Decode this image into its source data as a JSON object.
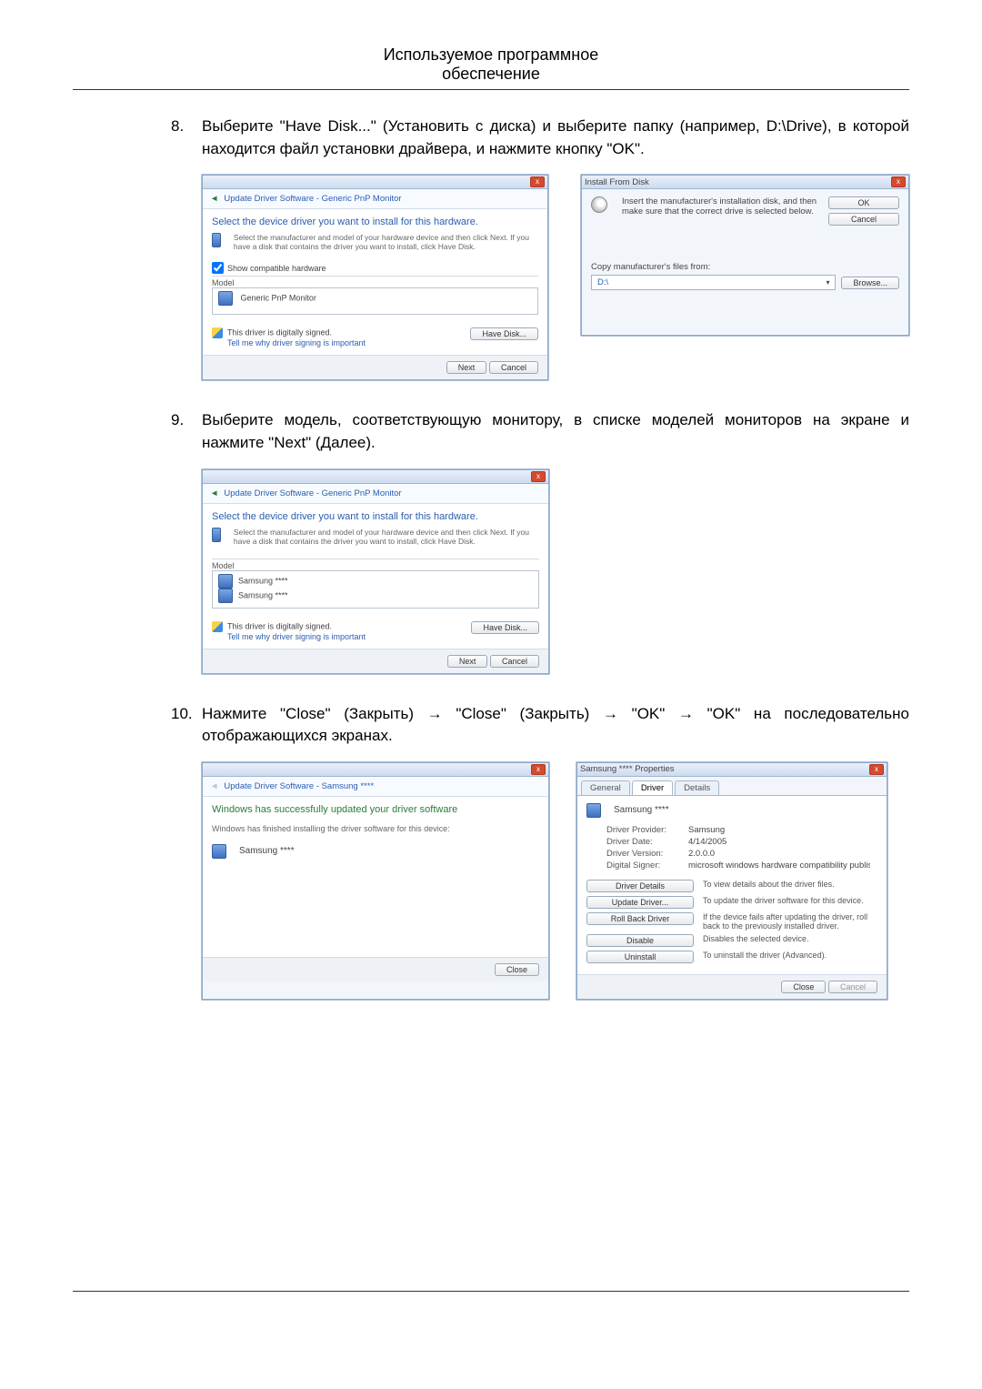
{
  "header": {
    "line1": "Используемое программное",
    "line2": "обеспечение"
  },
  "steps": {
    "s8": {
      "num": "8.",
      "text": "Выберите \"Have Disk...\" (Установить с диска) и выберите папку (например, D:\\Drive), в которой находится файл установки драйвера, и нажмите кнопку \"OK\"."
    },
    "s9": {
      "num": "9.",
      "text": "Выберите модель, соответствующую монитору, в списке моделей мониторов на экране и нажмите \"Next\" (Далее)."
    },
    "s10": {
      "num": "10.",
      "text": "Нажмите \"Close\" (Закрыть) → \"Close\" (Закрыть) → \"OK\" → \"OK\" на последовательно отображающихся экранах."
    }
  },
  "dlg_select1": {
    "title": "Update Driver Software - Generic PnP Monitor",
    "heading": "Select the device driver you want to install for this hardware.",
    "hint": "Select the manufacturer and model of your hardware device and then click Next. If you have a disk that contains the driver you want to install, click Have Disk.",
    "compat": "Show compatible hardware",
    "model_label": "Model",
    "model_item": "Generic PnP Monitor",
    "signed": "This driver is digitally signed.",
    "tell": "Tell me why driver signing is important",
    "have_disk": "Have Disk...",
    "next": "Next",
    "cancel": "Cancel"
  },
  "dlg_install_from_disk": {
    "title": "Install From Disk",
    "msg": "Insert the manufacturer's installation disk, and then make sure that the correct drive is selected below.",
    "ok": "OK",
    "cancel": "Cancel",
    "copy_label": "Copy manufacturer's files from:",
    "path": "D:\\",
    "browse": "Browse..."
  },
  "dlg_select2": {
    "title": "Update Driver Software - Generic PnP Monitor",
    "heading": "Select the device driver you want to install for this hardware.",
    "hint": "Select the manufacturer and model of your hardware device and then click Next. If you have a disk that contains the driver you want to install, click Have Disk.",
    "model_label": "Model",
    "model_items": [
      "Samsung ****",
      "Samsung ****"
    ],
    "signed": "This driver is digitally signed.",
    "tell": "Tell me why driver signing is important",
    "have_disk": "Have Disk...",
    "next": "Next",
    "cancel": "Cancel"
  },
  "dlg_success": {
    "title": "Update Driver Software - Samsung ****",
    "heading": "Windows has successfully updated your driver software",
    "sub": "Windows has finished installing the driver software for this device:",
    "device": "Samsung ****",
    "close": "Close"
  },
  "dlg_props": {
    "title": "Samsung **** Properties",
    "tabs": [
      "General",
      "Driver",
      "Details"
    ],
    "device": "Samsung ****",
    "rows": [
      {
        "k": "Driver Provider:",
        "v": "Samsung"
      },
      {
        "k": "Driver Date:",
        "v": "4/14/2005"
      },
      {
        "k": "Driver Version:",
        "v": "2.0.0.0"
      },
      {
        "k": "Digital Signer:",
        "v": "microsoft windows hardware compatibility publisher"
      }
    ],
    "buttons": [
      {
        "label": "Driver Details",
        "desc": "To view details about the driver files."
      },
      {
        "label": "Update Driver...",
        "desc": "To update the driver software for this device."
      },
      {
        "label": "Roll Back Driver",
        "desc": "If the device fails after updating the driver, roll back to the previously installed driver."
      },
      {
        "label": "Disable",
        "desc": "Disables the selected device."
      },
      {
        "label": "Uninstall",
        "desc": "To uninstall the driver (Advanced)."
      }
    ],
    "close": "Close",
    "cancel": "Cancel"
  }
}
